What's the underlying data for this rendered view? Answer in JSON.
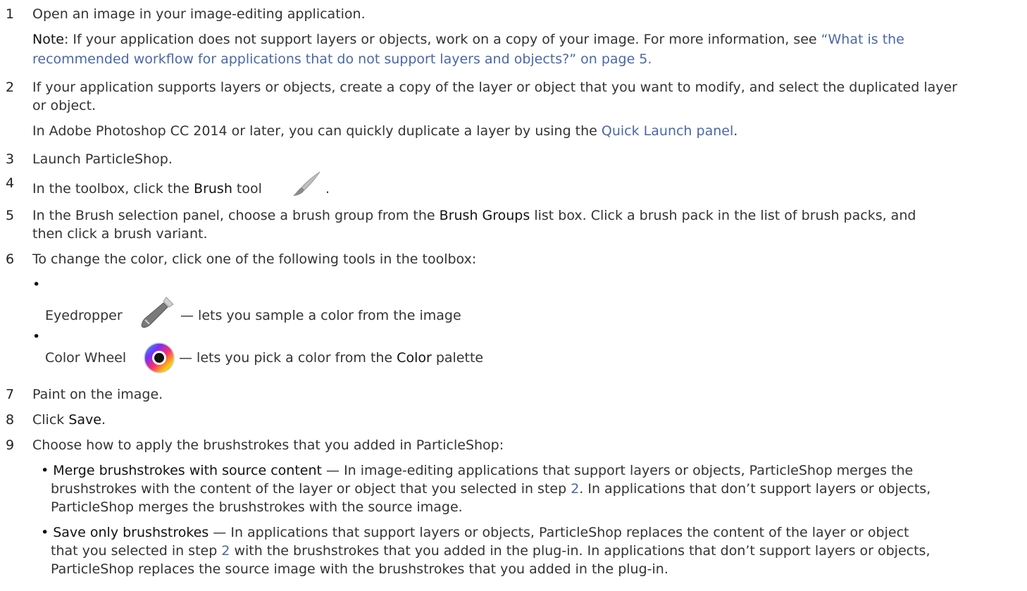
{
  "steps": {
    "s1": {
      "num": "1",
      "text": "Open an image in your image-editing application.",
      "note_label": "Note",
      "note_text": ": If your application does not support layers or objects, work on a copy of your image. For more information, see ",
      "note_link_1": "“What is the",
      "note_link_2": "recommended workflow for applications that do not support layers and objects?” on page 5."
    },
    "s2": {
      "num": "2",
      "text_1": "If your application supports layers or objects, create a copy of the layer or object that you want to modify, and select the duplicated layer",
      "text_2": "or object.",
      "extra": "In Adobe Photoshop CC 2014 or later, you can quickly duplicate a layer by using the ",
      "extra_link": "Quick Launch panel",
      "extra_end": "."
    },
    "s3": {
      "num": "3",
      "text": "Launch ParticleShop."
    },
    "s4": {
      "num": "4",
      "pre": "In the toolbox, click the ",
      "bold": "Brush",
      "post": " tool",
      "end": "."
    },
    "s5": {
      "num": "5",
      "pre": "In the Brush selection panel, choose a brush group from the ",
      "bold": "Brush Groups",
      "post": " list box. Click a brush pack in the list of brush packs, and",
      "text_2": "then click a brush variant."
    },
    "s6": {
      "num": "6",
      "text": "To change the color, click one of the following tools in the toolbox:",
      "bullet_1_bold": "Eyedropper",
      "bullet_1_text": "— lets you sample a color from the image",
      "bullet_2_bold": "Color Wheel",
      "bullet_2_pre": "— lets you pick a color from the ",
      "bullet_2_bold2": "Color",
      "bullet_2_post": " palette"
    },
    "s7": {
      "num": "7",
      "text": "Paint on the image."
    },
    "s8": {
      "num": "8",
      "pre": "Click ",
      "bold": "Save",
      "post": "."
    },
    "s9": {
      "num": "9",
      "text": "Choose how to apply the brushstrokes that you added in ParticleShop:",
      "opt1_bold": "Merge brushstrokes with source content",
      "opt1_l1": " — In image-editing applications that support layers or objects, ParticleShop merges the",
      "opt1_l2_pre": "brushstrokes with the content of the layer or object that you selected in step ",
      "opt1_l2_link": "2",
      "opt1_l2_post": ". In applications that don’t support layers or objects,",
      "opt1_l3": "ParticleShop merges the brushstrokes with the source image.",
      "opt2_bold": "Save only brushstrokes",
      "opt2_l1": " — In applications that support layers or objects, ParticleShop replaces the content of the layer or object",
      "opt2_l2_pre": "that you selected in step ",
      "opt2_l2_link": "2",
      "opt2_l2_post": " with the brushstrokes that you added in the plug-in. In applications that don’t support layers or objects,",
      "opt2_l3": "ParticleShop replaces the source image with the brushstrokes that you added in the plug-in."
    }
  },
  "icons": {
    "brush": "brush-icon",
    "eyedropper": "eyedropper-icon",
    "color_wheel": "color-wheel-icon"
  }
}
